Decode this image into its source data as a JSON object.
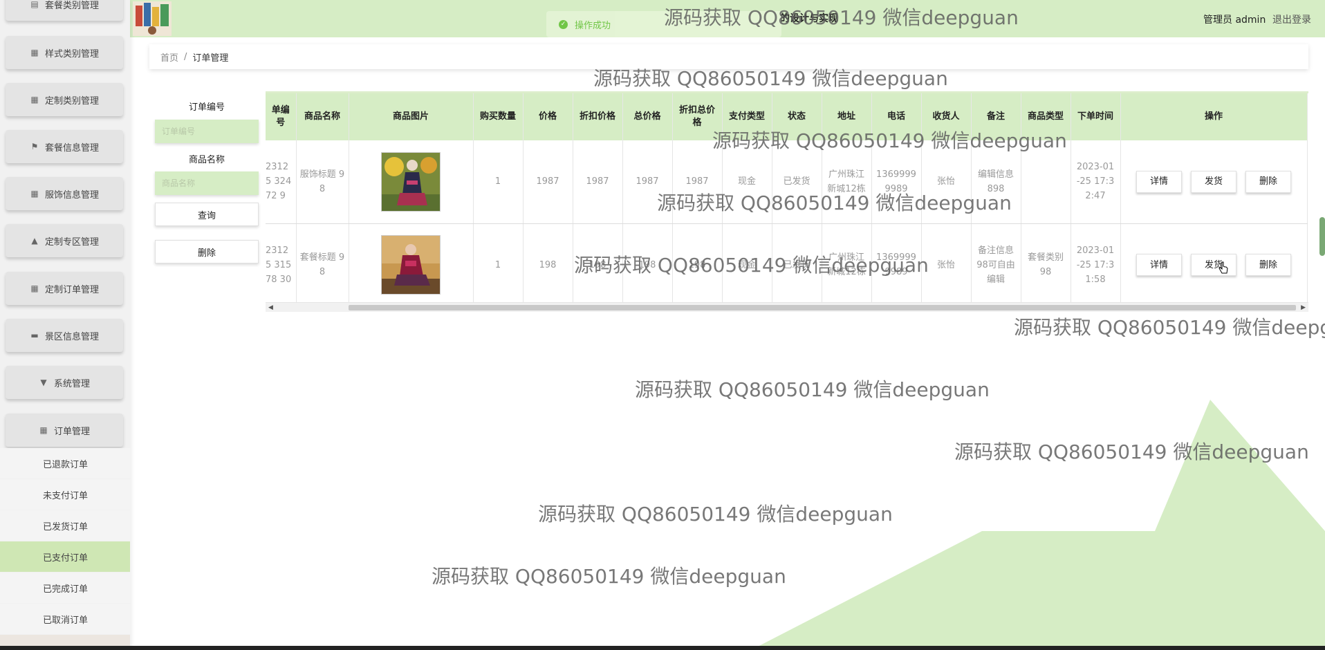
{
  "header": {
    "title": "的设计与实现",
    "user": "管理员 admin",
    "logout": "退出登录"
  },
  "toast": {
    "text": "操作成功"
  },
  "sidebar": {
    "items": [
      {
        "label": "套餐类别管理",
        "icon": "list-icon"
      },
      {
        "label": "样式类别管理",
        "icon": "grid-icon"
      },
      {
        "label": "定制类别管理",
        "icon": "grid-icon"
      },
      {
        "label": "套餐信息管理",
        "icon": "flag-icon"
      },
      {
        "label": "服饰信息管理",
        "icon": "grid-icon"
      },
      {
        "label": "定制专区管理",
        "icon": "thumb-icon"
      },
      {
        "label": "定制订单管理",
        "icon": "grid-icon"
      },
      {
        "label": "景区信息管理",
        "icon": "chat-icon"
      },
      {
        "label": "系统管理",
        "icon": "monitor-icon"
      },
      {
        "label": "订单管理",
        "icon": "grid-icon"
      }
    ],
    "subitems": [
      {
        "label": "已退款订单"
      },
      {
        "label": "未支付订单"
      },
      {
        "label": "已发货订单"
      },
      {
        "label": "已支付订单"
      },
      {
        "label": "已完成订单"
      },
      {
        "label": "已取消订单"
      }
    ]
  },
  "breadcrumb": {
    "home": "首页",
    "sep": "/",
    "current": "订单管理"
  },
  "filter": {
    "order_no_label": "订单编号",
    "order_no_placeholder": "订单编号",
    "product_name_label": "商品名称",
    "product_name_placeholder": "商品名称",
    "query_button": "查询",
    "delete_button": "删除"
  },
  "table": {
    "columns": [
      "单编号",
      "商品名称",
      "商品图片",
      "购买数量",
      "价格",
      "折扣价格",
      "总价格",
      "折扣总价格",
      "支付类型",
      "状态",
      "地址",
      "电话",
      "收货人",
      "备注",
      "商品类型",
      "下单时间",
      "操作"
    ],
    "rows": [
      {
        "order_no": "23125 32472 9",
        "name": "服饰标题 98",
        "qty": "1",
        "price": "1987",
        "discount_price": "1987",
        "total": "1987",
        "discount_total": "1987",
        "pay_type": "现金",
        "status": "已发货",
        "address": "广州珠江 新城12栋",
        "phone": "1369999 9989",
        "receiver": "张怡",
        "note": "编辑信息 898",
        "ptype": "",
        "time": "2023-01 -25 17:3 2:47"
      },
      {
        "order_no": "23125 31578 30",
        "name": "套餐标题 98",
        "qty": "1",
        "price": "198",
        "discount_price": "198",
        "total": "198",
        "discount_total": "198",
        "pay_type": "现金",
        "status": "已发货",
        "address": "广州珠江 新城12栋",
        "phone": "1369999 9989",
        "receiver": "张怡",
        "note": "备注信息 98可自由 编辑",
        "ptype": "套餐类别 98",
        "time": "2023-01 -25 17:3 1:58"
      }
    ],
    "actions": {
      "detail": "详情",
      "ship": "发货",
      "delete": "删除"
    }
  },
  "watermark": "源码获取 QQ86050149 微信deepguan",
  "colors": {
    "accent": "#d6edc5",
    "active": "#cfe7b4",
    "success": "#67c23a"
  }
}
